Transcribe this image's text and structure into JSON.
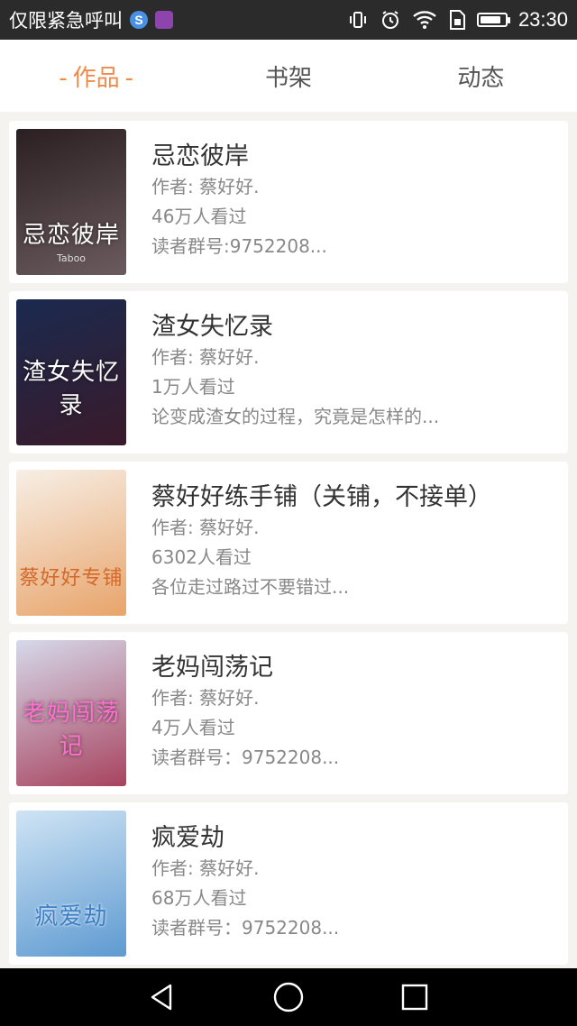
{
  "status_bar": {
    "notification_text": "仅限紧急呼叫",
    "time": "23:30",
    "battery_level_percent": 85,
    "icons": [
      "app-s-icon",
      "gallery-app-icon",
      "vibrate-icon",
      "alarm-icon",
      "wifi-icon",
      "sim-icon",
      "battery-icon"
    ]
  },
  "tabs": [
    {
      "label": "作品",
      "active": true,
      "decoration": "-"
    },
    {
      "label": "书架",
      "active": false
    },
    {
      "label": "动态",
      "active": false
    }
  ],
  "books": [
    {
      "title": "忌恋彼岸",
      "author": "作者: 蔡好好.",
      "views": "46万人看过",
      "extra": "读者群号:9752208...",
      "cover_title": "忌恋彼岸",
      "cover_sub": "Taboo",
      "cover_colors": [
        "#2a1f22",
        "#6b5b5e"
      ]
    },
    {
      "title": "渣女失忆录",
      "author": "作者: 蔡好好.",
      "views": "1万人看过",
      "extra": "论变成渣女的过程，究竟是怎样的...",
      "cover_title": "渣女失忆录",
      "cover_sub": "",
      "cover_colors": [
        "#1a2a4f",
        "#3a1a2a"
      ]
    },
    {
      "title": "蔡好好练手铺（关铺，不接单）",
      "author": "作者: 蔡好好.",
      "views": "6302人看过",
      "extra": "各位走过路过不要错过...",
      "cover_title": "蔡好好专铺",
      "cover_sub": "",
      "cover_colors": [
        "#f7efe6",
        "#e8a46a"
      ]
    },
    {
      "title": "老妈闯荡记",
      "author": "作者: 蔡好好.",
      "views": "4万人看过",
      "extra": "读者群号：9752208...",
      "cover_title": "老妈闯荡记",
      "cover_sub": "",
      "cover_colors": [
        "#d6d9ea",
        "#a8435f"
      ]
    },
    {
      "title": "疯爱劫",
      "author": "作者: 蔡好好.",
      "views": "68万人看过",
      "extra": "读者群号：9752208...",
      "cover_title": "疯爱劫",
      "cover_sub": "",
      "cover_colors": [
        "#cfe4f4",
        "#5e9ad1"
      ]
    }
  ],
  "nav_bar": {
    "buttons": [
      "back-icon",
      "home-icon",
      "recents-icon"
    ]
  },
  "colors": {
    "accent": "#f08a4b",
    "background": "#f4f3ef",
    "status_bar": "#2b2b2b"
  }
}
